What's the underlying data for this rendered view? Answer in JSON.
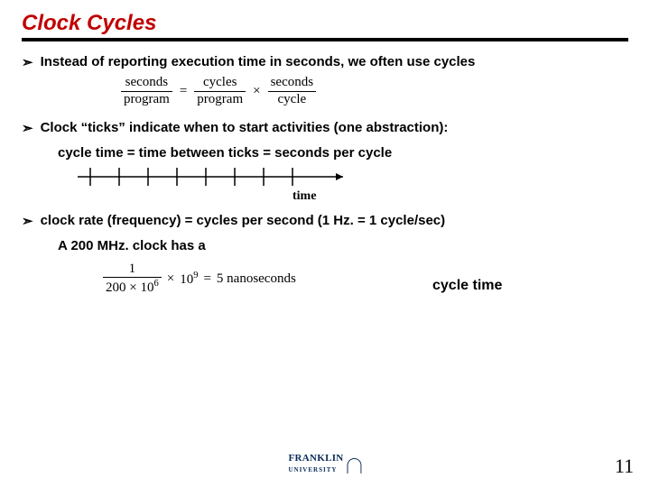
{
  "title": "Clock Cycles",
  "bullets": {
    "b1": "Instead of reporting execution time in seconds, we often use cycles",
    "b2": "Clock “ticks” indicate when to start activities (one abstraction):",
    "b3": "clock rate (frequency) = cycles per second  (1 Hz. = 1 cycle/sec)"
  },
  "formula1": {
    "lhs_num": "seconds",
    "lhs_den": "program",
    "eq": "=",
    "mid_num": "cycles",
    "mid_den": "program",
    "times": "×",
    "rhs_num": "seconds",
    "rhs_den": "cycle"
  },
  "cycle_line": "cycle time = time between ticks = seconds per cycle",
  "time_label": "time",
  "clock_example": "A 200 MHz. clock has a",
  "formula2": {
    "lhs_num": "1",
    "lhs_den1": "200",
    "times1": "×",
    "lhs_den2": "10",
    "lhs_den2_exp": "6",
    "times2": "×",
    "rhs": "10",
    "rhs_exp": "9",
    "eq": "=",
    "result": "5 nanoseconds"
  },
  "cycle_time_label": "cycle time",
  "logo": {
    "name": "FRANKLIN",
    "sub": "UNIVERSITY"
  },
  "page_number": "11"
}
